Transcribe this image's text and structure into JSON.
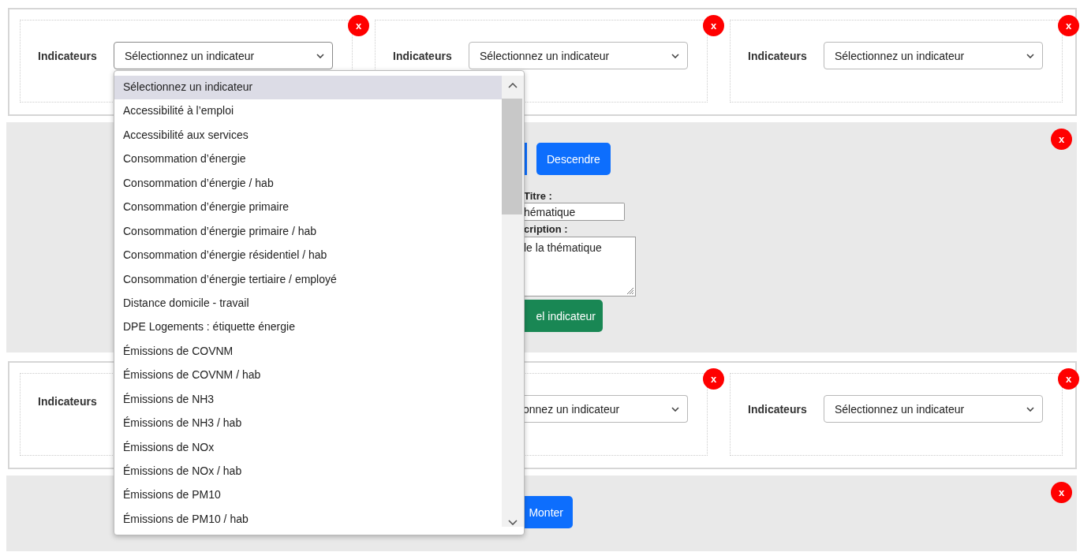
{
  "sections": [
    {
      "kind": "indicators",
      "cards": [
        {
          "label": "Indicateurs",
          "value": "Sélectionnez un indicateur",
          "close": "x",
          "open": true,
          "options": [
            {
              "label": "Sélectionnez un indicateur",
              "selected": true
            },
            {
              "label": "Accessibilité à l’emploi",
              "selected": false
            },
            {
              "label": "Accessibilité aux services",
              "selected": false
            },
            {
              "label": "Consommation d’énergie",
              "selected": false
            },
            {
              "label": "Consommation d’énergie / hab",
              "selected": false
            },
            {
              "label": "Consommation d’énergie primaire",
              "selected": false
            },
            {
              "label": "Consommation d’énergie primaire / hab",
              "selected": false
            },
            {
              "label": "Consommation d’énergie résidentiel / hab",
              "selected": false
            },
            {
              "label": "Consommation d’énergie tertiaire / employé",
              "selected": false
            },
            {
              "label": "Distance domicile - travail",
              "selected": false
            },
            {
              "label": "DPE Logements : étiquette énergie",
              "selected": false
            },
            {
              "label": "Émissions de COVNM",
              "selected": false
            },
            {
              "label": "Émissions de COVNM / hab",
              "selected": false
            },
            {
              "label": "Émissions de NH3",
              "selected": false
            },
            {
              "label": "Émissions de NH3 / hab",
              "selected": false
            },
            {
              "label": "Émissions de NOx",
              "selected": false
            },
            {
              "label": "Émissions de NOx / hab",
              "selected": false
            },
            {
              "label": "Émissions de PM10",
              "selected": false
            },
            {
              "label": "Émissions de PM10 / hab",
              "selected": false
            }
          ]
        },
        {
          "label": "Indicateurs",
          "value": "Sélectionnez un indicateur",
          "close": "x"
        },
        {
          "label": "Indicateurs",
          "value": "Sélectionnez un indicateur",
          "close": "x"
        }
      ]
    },
    {
      "kind": "theme",
      "close": "x",
      "move_buttons": [
        {
          "label": "Descendre"
        }
      ],
      "title_label": "Titre :",
      "title_value": "hématique",
      "description_label": "cription :",
      "description_value": "le la thématique",
      "add_button": "el indicateur"
    },
    {
      "kind": "indicators",
      "cards": [
        {
          "label": "Indicateurs"
        },
        {
          "value": "onnez un indicateur",
          "close": "x"
        },
        {
          "label": "Indicateurs",
          "value": "Sélectionnez un indicateur",
          "close": "x"
        }
      ]
    },
    {
      "kind": "theme",
      "close": "x",
      "move_buttons": [
        {
          "label": "Monter"
        }
      ]
    }
  ]
}
